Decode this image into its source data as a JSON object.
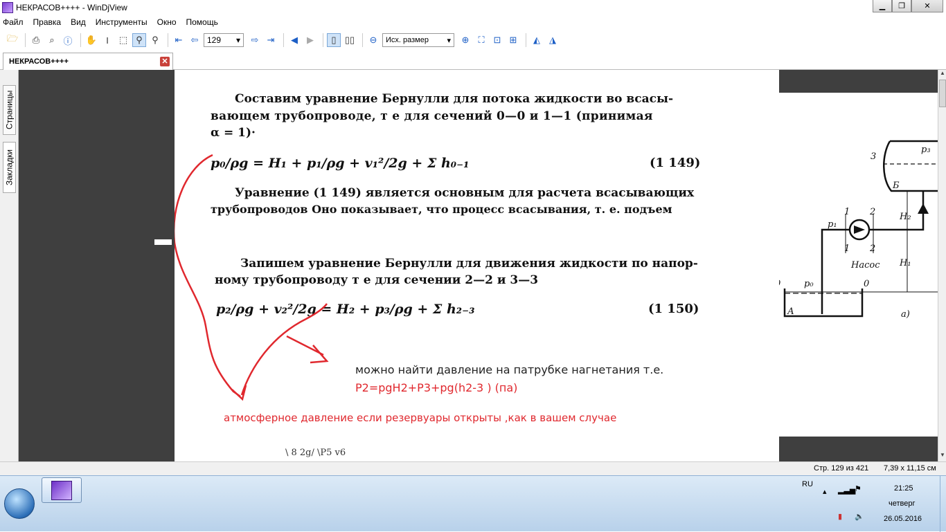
{
  "window": {
    "title": "НЕКРАСОВ++++ - WinDjView"
  },
  "menu": [
    "Файл",
    "Правка",
    "Вид",
    "Инструменты",
    "Окно",
    "Помощь"
  ],
  "toolbar": {
    "page_number": "129",
    "zoom": "Исх. размер"
  },
  "tab": {
    "label": "НЕКРАСОВ++++"
  },
  "sidebar": {
    "tabs": [
      "Страницы",
      "Закладки"
    ]
  },
  "document": {
    "para1_l1": "Составим уравнение Бернулли для потока жидкости во всасы-",
    "para1_l2": "вающем трубопроводе, т е для сечений 0—0 и 1—1 (принимая",
    "para1_l3": "α = 1)·",
    "eq1_body": "p₀/ρg = H₁ + p₁/ρg + v₁²/2g + Σ h₀₋₁",
    "eq1_num": "(1 149)",
    "para2_l1": "Уравнение (1 149) является основным для расчета всасывающих",
    "para2_l2": "трубопроводов Оно показывает, что процесс всасывания, т. е. подъем",
    "para3_l1": "Запишем уравнение Бернулли для движения жидкости по напор-",
    "para3_l2": "ному трубопроводу т е для сечении 2—2 и 3—3",
    "eq2_body": "p₂/ρg + v₂²/2g = H₂ + p₃/ρg + Σ h₂₋₃",
    "eq2_num": "(1 150)",
    "bottom_fragment": "\\ 8    2g/      \\P5                              v6",
    "diagram_labels": {
      "n3": "3",
      "p3": "p₃",
      "b": "Б",
      "h2": "H₂",
      "s1a": "1",
      "s2a": "2",
      "p1": "p₁",
      "s1b": "1",
      "s2b": "2",
      "pump": "Насос",
      "h1": "H₁",
      "n0": "0",
      "p0": "p₀",
      "n0b": "0",
      "a_tank": "А",
      "fig": "а)"
    }
  },
  "annotations": {
    "note1": "можно найти давление на патрубке нагнетания т.е.",
    "formula": "P2=pgH2+P3+pg(h2-3 )   (па)",
    "note2": "атмосферное давление если резервуары открыты ,как в вашем случае",
    "color_red": "#e0282e"
  },
  "status": {
    "page": "Стр. 129 из 421",
    "size": "7,39 x 11,15 см"
  },
  "tray": {
    "lang": "RU",
    "time": "21:25",
    "day": "четверг",
    "date": "26.05.2016"
  }
}
